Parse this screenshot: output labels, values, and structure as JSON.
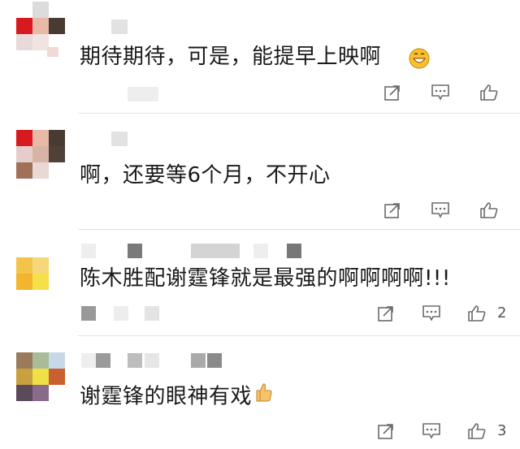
{
  "comments": [
    {
      "text": "期待期待，可是，能提早上映啊",
      "emoji": "grinning-face-emoji",
      "like_count": ""
    },
    {
      "text": "啊，还要等6个月，不开心",
      "emoji": "",
      "like_count": ""
    },
    {
      "text": "陈木胜配谢霆锋就是最强的啊啊啊啊!!!",
      "emoji": "",
      "like_count": "2"
    },
    {
      "text": "谢霆锋的眼神有戏",
      "emoji": "thumbs-up-emoji",
      "like_count": "3"
    }
  ],
  "icons": {
    "share": "share-icon",
    "comment": "comment-icon",
    "like": "like-icon"
  },
  "colors": {
    "icon": "#6b6b6b",
    "text": "#1a1a1a"
  }
}
